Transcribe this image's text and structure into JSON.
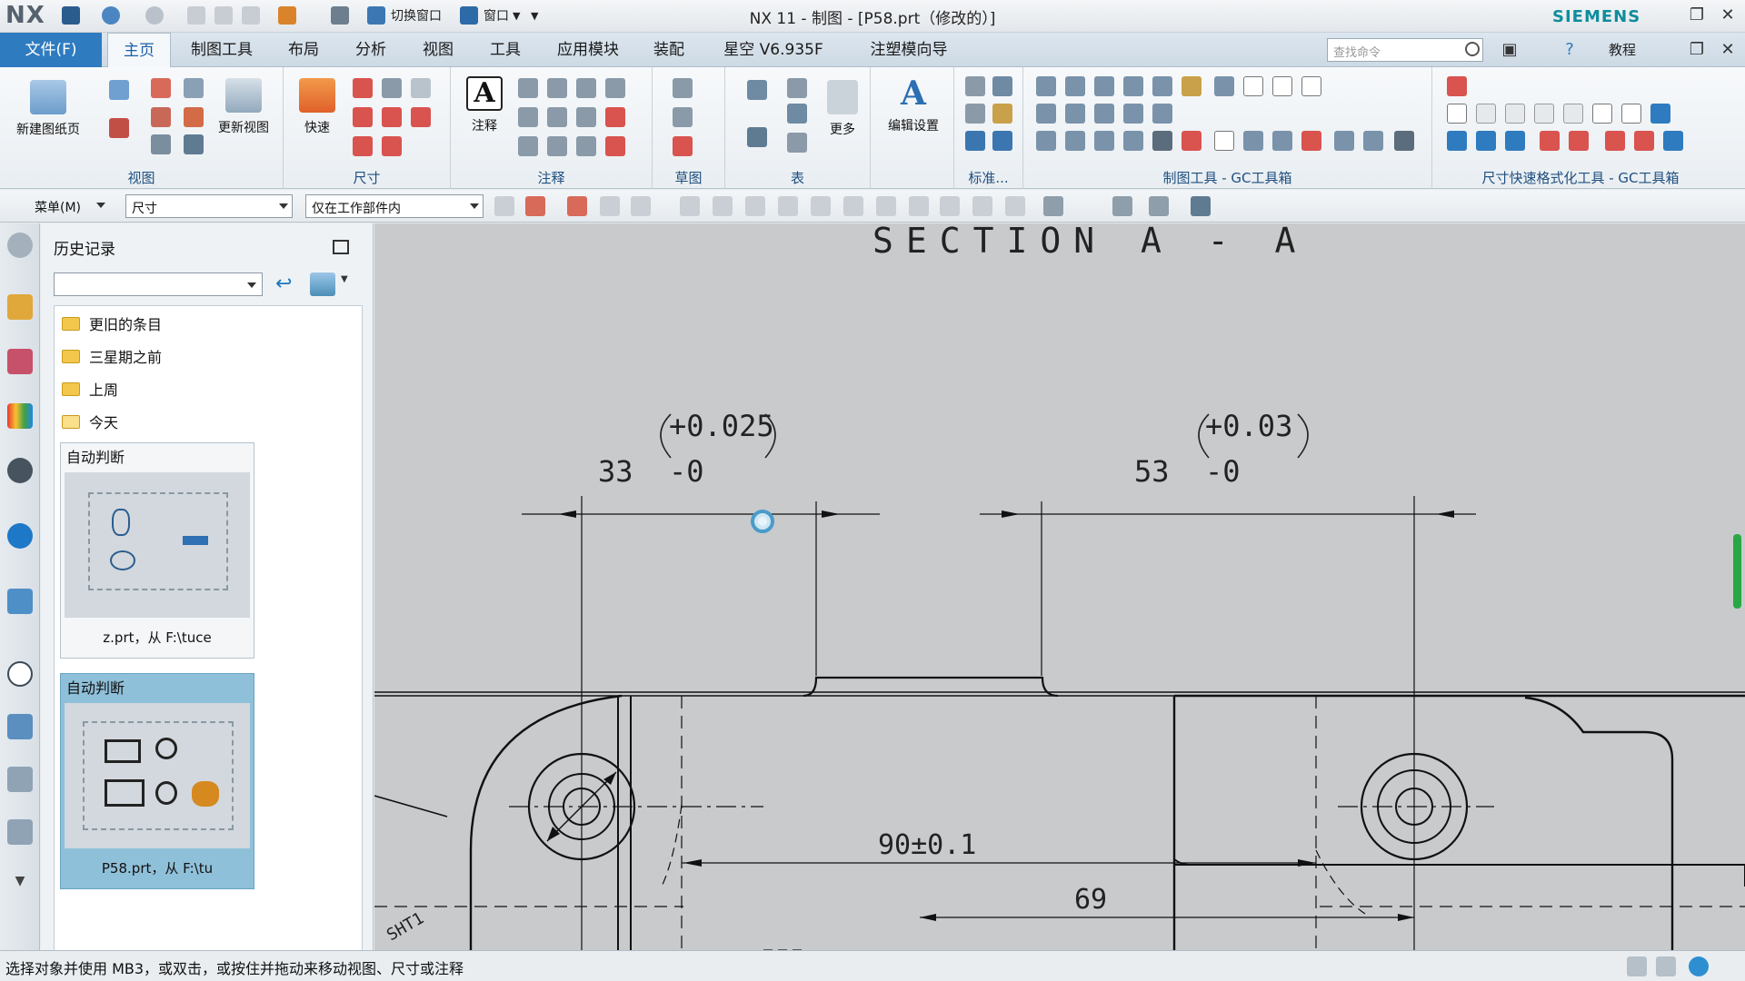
{
  "titlebar": {
    "logo": "NX",
    "switch_window": "切换窗口",
    "window_menu": "窗口",
    "title": "NX 11 - 制图 - [P58.prt（修改的）]",
    "brand": "SIEMENS"
  },
  "menubar": {
    "file": "文件(F)",
    "tabs": [
      "主页",
      "制图工具",
      "布局",
      "分析",
      "视图",
      "工具",
      "应用模块",
      "装配",
      "星空 V6.935F",
      "注塑模向导"
    ],
    "active_tab": "主页",
    "search_placeholder": "查找命令",
    "help_label": "教程"
  },
  "ribbon": {
    "new_sheet": "新建图纸页",
    "update_view": "更新视图",
    "rapid": "快速",
    "note": "注释",
    "more": "更多",
    "edit_settings": "编辑设置",
    "groups": {
      "view": "视图",
      "dimension": "尺寸",
      "annotation": "注释",
      "sketch": "草图",
      "table": "表",
      "standard": "标准...",
      "gc_drafting": "制图工具 - GC工具箱",
      "gc_dim_format": "尺寸快速格式化工具 - GC工具箱"
    }
  },
  "selection_bar": {
    "menu": "菜单(M)",
    "type_filter": "尺寸",
    "scope": "仅在工作部件内"
  },
  "history": {
    "title": "历史记录",
    "folders": [
      "更旧的条目",
      "三星期之前",
      "上周",
      "今天"
    ],
    "cards": [
      {
        "title": "自动判断",
        "caption": "z.prt，从 F:\\tuce"
      },
      {
        "title": "自动判断",
        "caption": "P58.prt，从 F:\\tu"
      }
    ]
  },
  "drawing": {
    "section_label": "SECTION  A - A",
    "dim1_nominal": "33",
    "dim1_upper": "+0.025",
    "dim1_lower": "-0",
    "dim2_nominal": "53",
    "dim2_upper": "+0.03",
    "dim2_lower": "-0",
    "dim3": "90±0.1",
    "dim4": "69",
    "sheet_label": "SHT1"
  },
  "status": {
    "text": "选择对象并使用 MB3，或双击，或按住并拖动来移动视图、尺寸或注释"
  },
  "colors": {
    "accent": "#2f7bbf",
    "brand": "#0e8d9c",
    "canvas": "#c8cacc",
    "scroll": "#28a845"
  }
}
